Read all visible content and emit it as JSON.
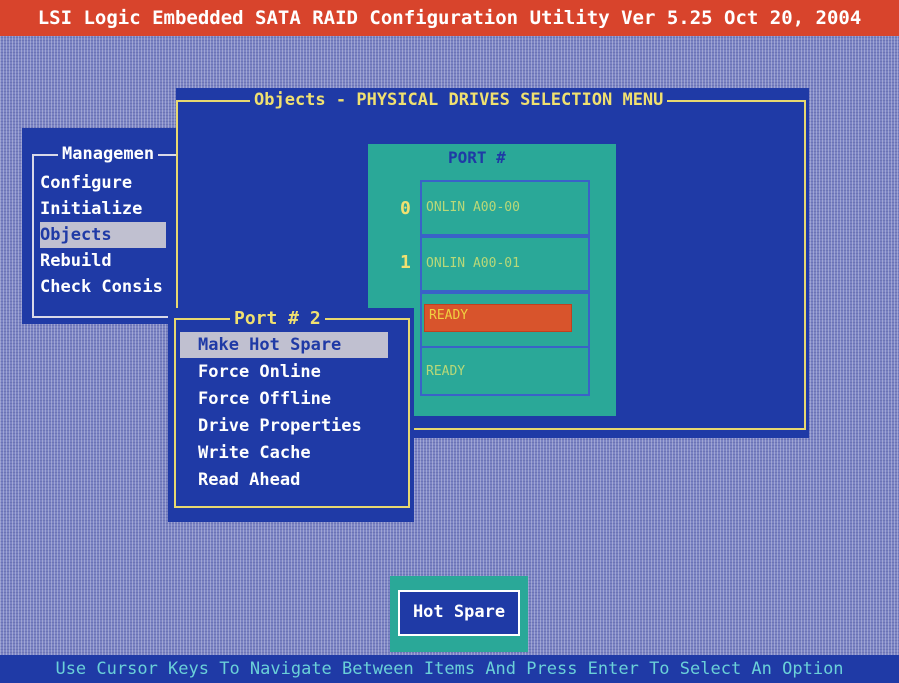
{
  "window": {
    "title": "LSI Logic Embedded SATA RAID Configuration Utility Ver 5.25 Oct 20, 2004"
  },
  "management_menu": {
    "title": "Managemen",
    "items": [
      {
        "label": "Configure"
      },
      {
        "label": "Initialize"
      },
      {
        "label": "Objects"
      },
      {
        "label": "Rebuild"
      },
      {
        "label": "Check Consis"
      }
    ],
    "selected_index": 2
  },
  "objects_menu": {
    "title": "Objects - PHYSICAL DRIVES SELECTION MENU"
  },
  "port_panel": {
    "header": "PORT #",
    "drives": [
      {
        "port": "0",
        "status": "ONLIN A00-00"
      },
      {
        "port": "1",
        "status": "ONLIN A00-01"
      },
      {
        "port": "",
        "status": "READY"
      },
      {
        "port": "",
        "status": "READY"
      }
    ],
    "selected_index": 2
  },
  "port_popup": {
    "title": "Port # 2",
    "items": [
      {
        "label": "Make Hot Spare"
      },
      {
        "label": "Force Online"
      },
      {
        "label": "Force Offline"
      },
      {
        "label": "Drive Properties"
      },
      {
        "label": "Write Cache"
      },
      {
        "label": "Read Ahead"
      }
    ],
    "selected_index": 0
  },
  "hot_spare_box": {
    "label": "Hot Spare"
  },
  "status_bar": {
    "text": "Use Cursor Keys To Navigate Between Items And Press Enter To Select An Option"
  }
}
